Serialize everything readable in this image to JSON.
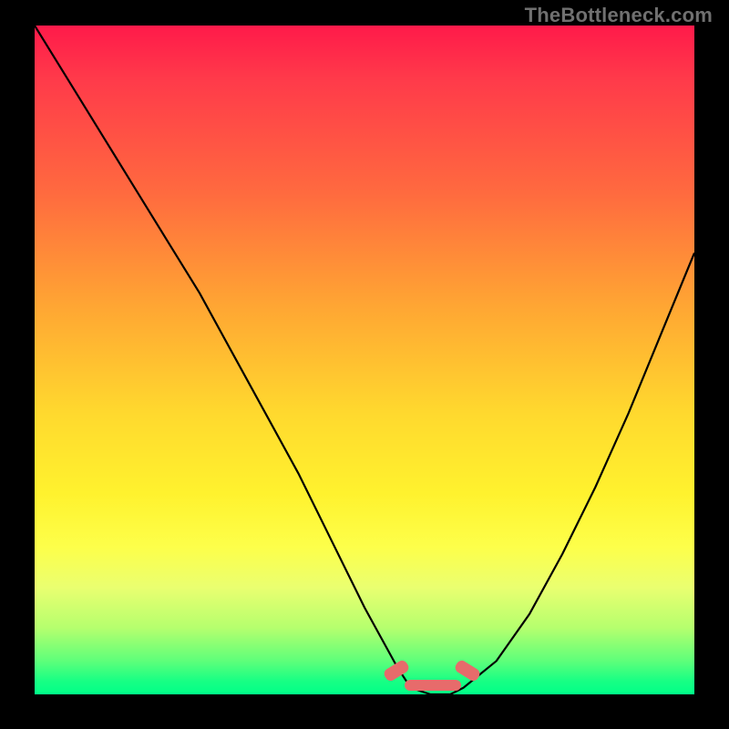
{
  "watermark": "TheBottleneck.com",
  "chart_data": {
    "type": "line",
    "title": "",
    "xlabel": "",
    "ylabel": "",
    "xlim": [
      0,
      100
    ],
    "ylim": [
      0,
      100
    ],
    "series": [
      {
        "name": "curve",
        "x": [
          0,
          5,
          10,
          15,
          20,
          25,
          30,
          35,
          40,
          45,
          50,
          55,
          57,
          60,
          63,
          65,
          70,
          75,
          80,
          85,
          90,
          95,
          100
        ],
        "values": [
          100,
          92,
          84,
          76,
          68,
          60,
          51,
          42,
          33,
          23,
          13,
          4,
          1,
          0,
          0,
          1,
          5,
          12,
          21,
          31,
          42,
          54,
          66
        ]
      }
    ],
    "highlight_band_x": [
      55,
      66
    ],
    "background_gradient_stops": [
      {
        "pos": 0,
        "color": "#ff1a4a"
      },
      {
        "pos": 25,
        "color": "#ff6a3f"
      },
      {
        "pos": 58,
        "color": "#ffd92e"
      },
      {
        "pos": 84,
        "color": "#eaff70"
      },
      {
        "pos": 100,
        "color": "#00ff88"
      }
    ]
  }
}
